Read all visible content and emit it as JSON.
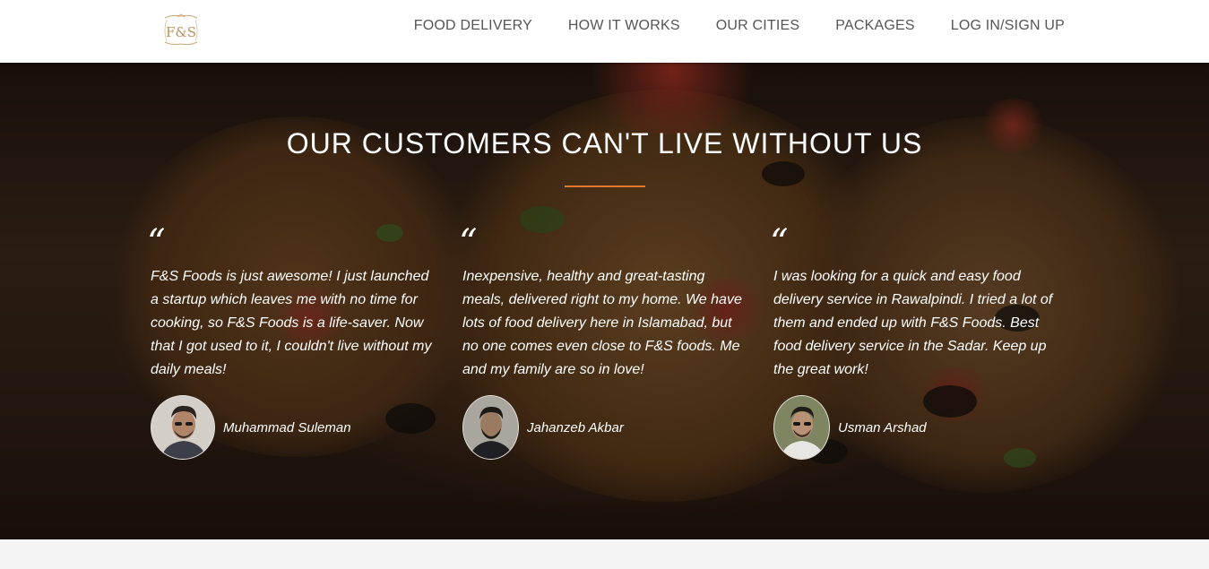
{
  "brand": {
    "logo_text": "F&S",
    "accent_color": "#e07a2e",
    "logo_color": "#b8925e"
  },
  "nav": {
    "items": [
      {
        "label": "FOOD DELIVERY"
      },
      {
        "label": "HOW IT WORKS"
      },
      {
        "label": "OUR CITIES"
      },
      {
        "label": "PACKAGES"
      },
      {
        "label": "LOG IN/SIGN UP"
      }
    ]
  },
  "testimonials": {
    "title": "OUR CUSTOMERS CAN'T LIVE WITHOUT US",
    "quote_mark": "“",
    "items": [
      {
        "text": "F&S Foods is just awesome! I just launched a startup which leaves me with no time for cooking, so F&S Foods is a life-saver. Now that I got used to it, I couldn't live without my daily meals!",
        "author": "Muhammad Suleman"
      },
      {
        "text": "Inexpensive, healthy and great-tasting meals, delivered right to my home. We have lots of food delivery here in Islamabad, but no one comes even close to F&S foods. Me and my family are so in love!",
        "author": "Jahanzeb Akbar"
      },
      {
        "text": "I was looking for a quick and easy food delivery service in Rawalpindi. I tried a lot of them and ended up with F&S Foods. Best food delivery service in the Sadar. Keep up the great work!",
        "author": "Usman Arshad"
      }
    ]
  }
}
